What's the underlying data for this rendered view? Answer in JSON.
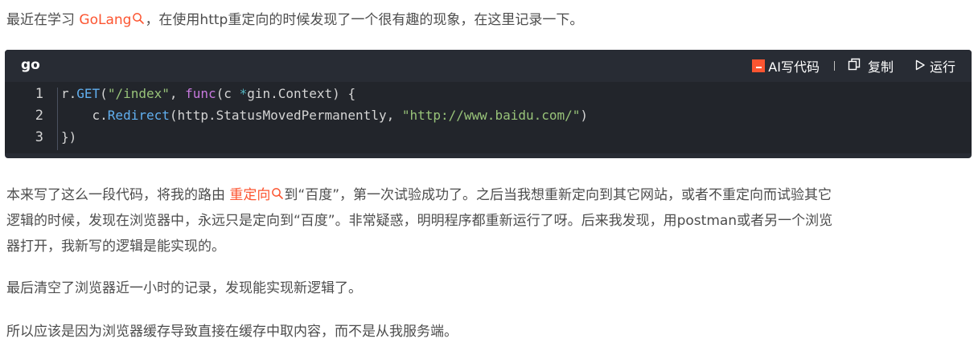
{
  "p1": {
    "before": "最近在学习 ",
    "link": "GoLang",
    "after": "，在使用http重定向的时候发现了一个很有趣的现象，在这里记录一下。"
  },
  "code": {
    "lang": "go",
    "tools": {
      "ai_label": "AI写代码",
      "copy_label": "复制",
      "run_label": "运行"
    },
    "lines": [
      {
        "num": "1",
        "tokens": [
          {
            "t": "r.",
            "c": "plain"
          },
          {
            "t": "GET",
            "c": "fn"
          },
          {
            "t": "(",
            "c": "plain"
          },
          {
            "t": "\"/index\"",
            "c": "str"
          },
          {
            "t": ", ",
            "c": "plain"
          },
          {
            "t": "func",
            "c": "kw"
          },
          {
            "t": "(c ",
            "c": "plain"
          },
          {
            "t": "*",
            "c": "op"
          },
          {
            "t": "gin.Context) {",
            "c": "plain"
          }
        ]
      },
      {
        "num": "2",
        "tokens": [
          {
            "t": "    c.",
            "c": "plain"
          },
          {
            "t": "Redirect",
            "c": "fn"
          },
          {
            "t": "(http.StatusMovedPermanently, ",
            "c": "plain"
          },
          {
            "t": "\"http://www.baidu.com/\"",
            "c": "str"
          },
          {
            "t": ")",
            "c": "plain"
          }
        ]
      },
      {
        "num": "3",
        "tokens": [
          {
            "t": "})",
            "c": "plain"
          }
        ]
      }
    ]
  },
  "p2": {
    "before": "本来写了这么一段代码，将我的路由 ",
    "link": "重定向",
    "after_line1": "到“百度”，第一次试验成功了。之后当我想重新定向到其它网站，或者不重定向而试验其它",
    "line2": "逻辑的时候，发现在浏览器中，永远只是定向到“百度”。非常疑惑，明明程序都重新运行了呀。后来我发现，用postman或者另一个浏览",
    "line3": "器打开，我新写的逻辑是能实现的。"
  },
  "p3": "最后清空了浏览器近一小时的记录，发现能实现新逻辑了。",
  "p4": "所以应该是因为浏览器缓存导致直接在缓存中取内容，而不是从我服务端。",
  "colors": {
    "link": "#fc5531",
    "code_bg": "#282c34",
    "text": "#4d4d4d"
  }
}
